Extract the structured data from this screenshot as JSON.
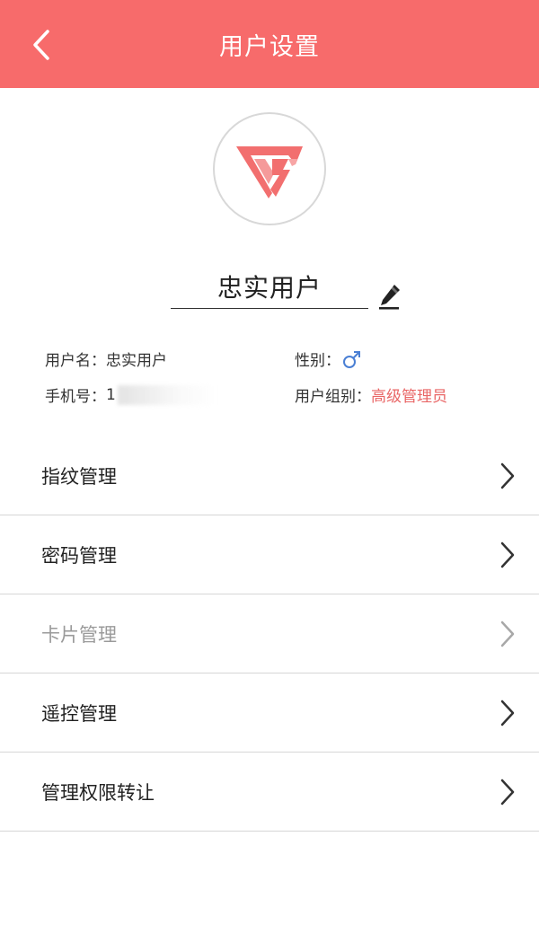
{
  "header": {
    "title": "用户设置",
    "background_color": "#f76b6b",
    "back_icon": "chevron-left-icon"
  },
  "profile": {
    "avatar_icon": "brand-logo",
    "display_name": "忠实用户",
    "edit_icon": "pencil-icon"
  },
  "info": {
    "username_label": "用户名：",
    "username_value": "忠实用户",
    "gender_label": "性别：",
    "gender_icon": "male-icon",
    "phone_label": "手机号：",
    "phone_value": "1",
    "group_label": "用户组别：",
    "group_value": "高级管理员",
    "accent_color": "#e96666"
  },
  "menu": {
    "items": [
      {
        "label": "指纹管理",
        "enabled": true
      },
      {
        "label": "密码管理",
        "enabled": true
      },
      {
        "label": "卡片管理",
        "enabled": false
      },
      {
        "label": "遥控管理",
        "enabled": true
      },
      {
        "label": "管理权限转让",
        "enabled": true
      }
    ],
    "chevron_icon": "chevron-right-icon"
  }
}
